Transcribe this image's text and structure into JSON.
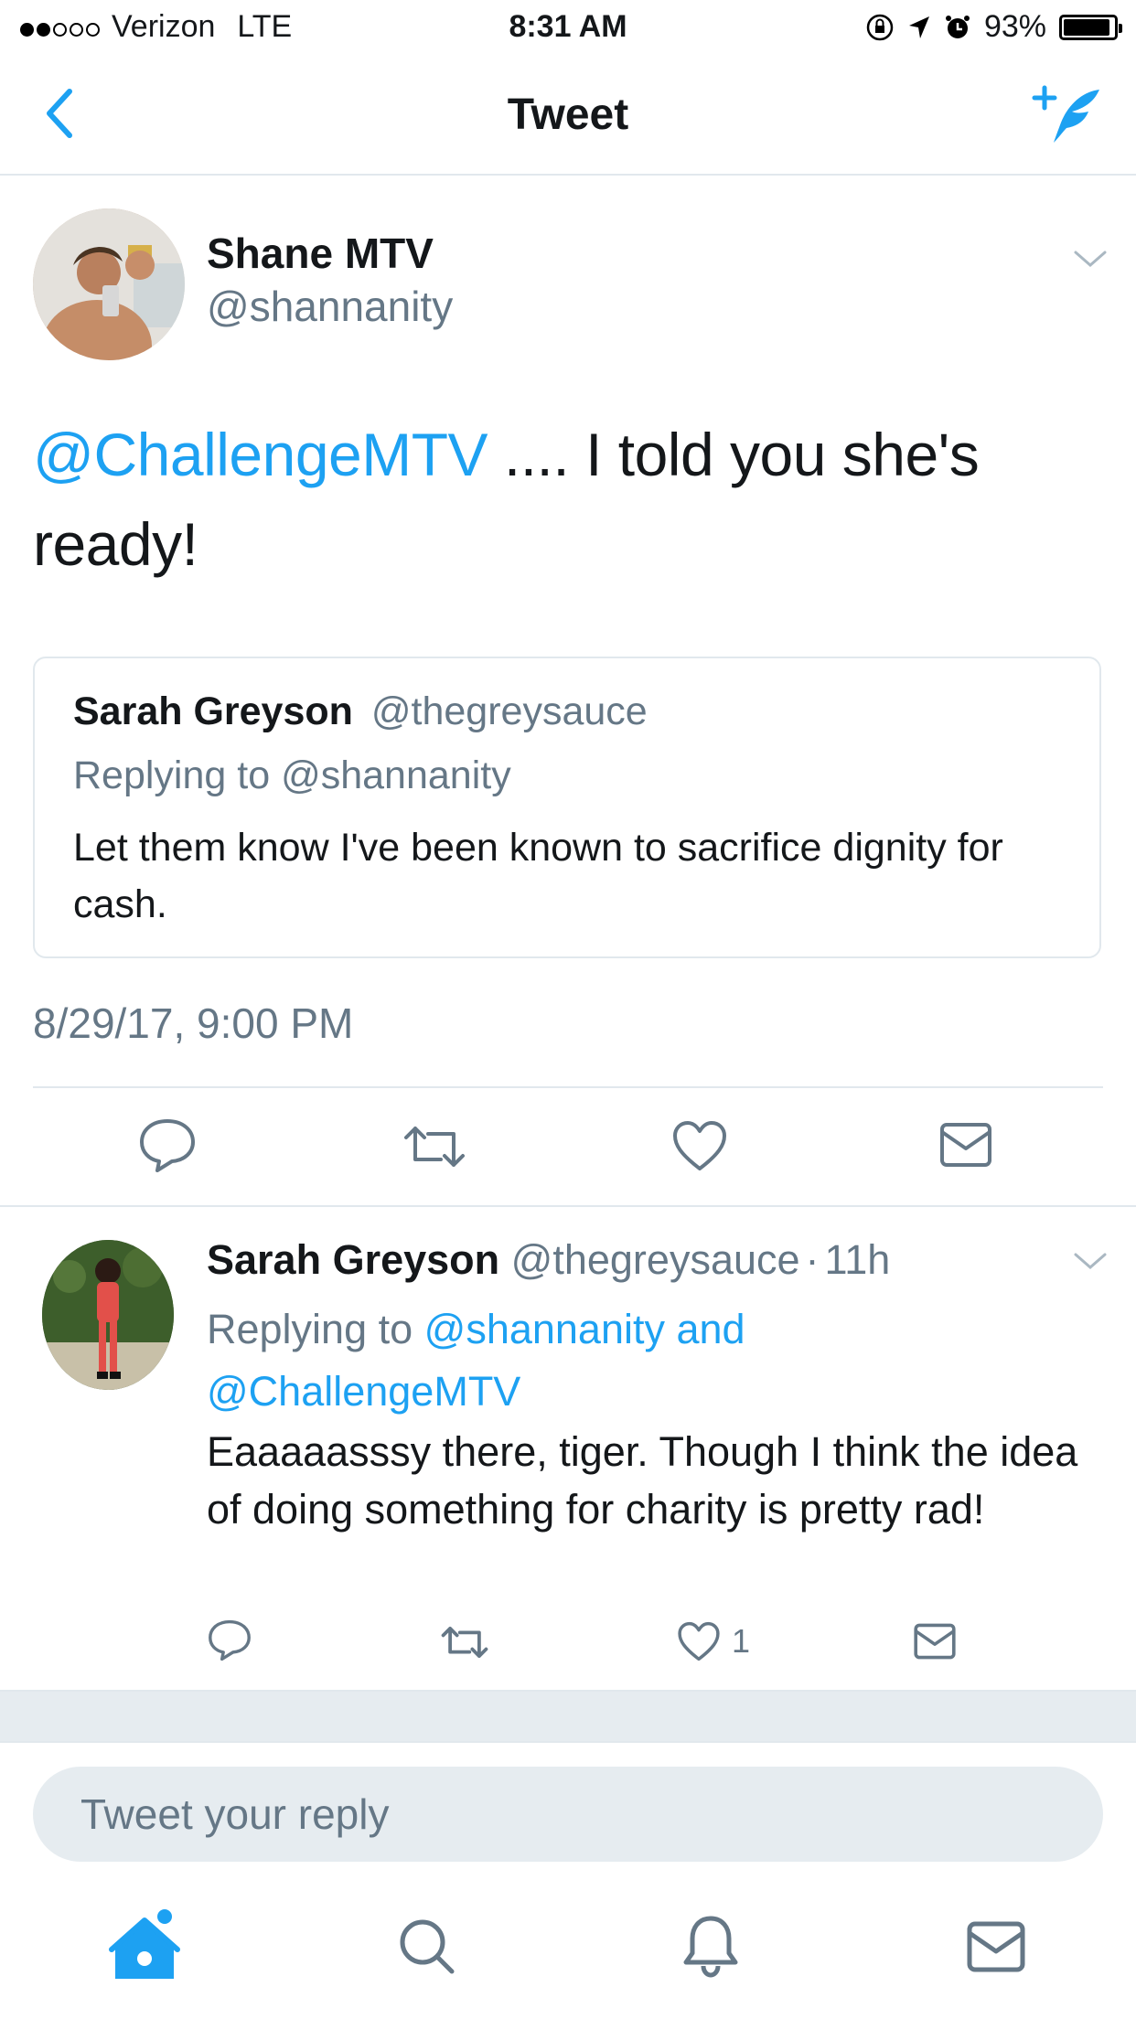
{
  "status_bar": {
    "carrier": "Verizon",
    "network": "LTE",
    "time": "8:31 AM",
    "battery": "93%",
    "battery_level": 0.93
  },
  "nav": {
    "back_icon": "chevron-left-icon",
    "title": "Tweet",
    "compose_icon": "compose-tweet-icon"
  },
  "tweet": {
    "author_name": "Shane MTV",
    "author_handle": "@shannanity",
    "mention": "@ChallengeMTV",
    "text_rest": " .... I told you she's ready!",
    "quote": {
      "author_name": "Sarah Greyson",
      "author_handle": "@thegreysauce",
      "replying_to": "Replying to @shannanity",
      "text": "Let them know I've been known to sacrifice dignity for cash."
    },
    "timestamp": "8/29/17, 9:00 PM"
  },
  "reply": {
    "author_name": "Sarah Greyson",
    "author_handle": "@thegreysauce",
    "separator": "·",
    "age": "11h",
    "replying_prefix": "Replying to ",
    "replying_targets": "@shannanity and",
    "replying_target2": "@ChallengeMTV",
    "text": "Eaaaaasssy there, tiger. Though I think the idea of doing something for charity is pretty rad!",
    "like_count": "1"
  },
  "composer": {
    "placeholder": "Tweet your reply"
  },
  "tab_bar": {
    "items": [
      "home-icon",
      "search-icon",
      "notifications-icon",
      "messages-icon"
    ]
  },
  "colors": {
    "accent": "#1da1f2",
    "text": "#14171a",
    "muted": "#657786",
    "border": "#e1e8ed",
    "input_bg": "#e6ecf0"
  }
}
